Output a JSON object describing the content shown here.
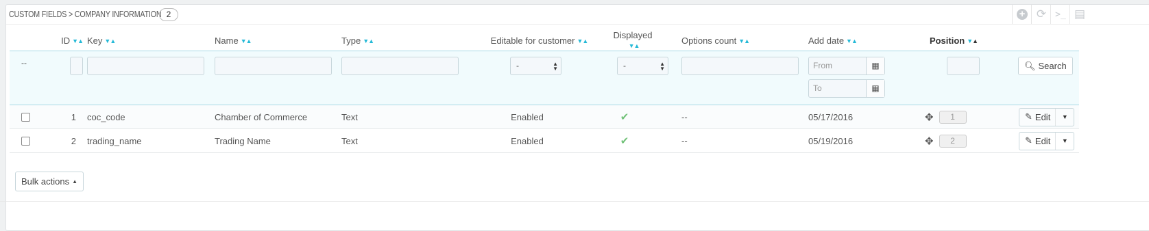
{
  "panel": {
    "title": "CUSTOM FIELDS > COMPANY INFORMATION",
    "count": "2",
    "toolbar": [
      {
        "name": "add-new-icon",
        "glyph": "+"
      },
      {
        "name": "refresh-icon",
        "glyph": "⟳"
      },
      {
        "name": "sql-query-icon",
        "glyph": ">_"
      },
      {
        "name": "export-icon",
        "glyph": "▤"
      }
    ]
  },
  "columns": {
    "id": "ID",
    "key": "Key",
    "name": "Name",
    "type": "Type",
    "editable": "Editable for customer",
    "displayed": "Displayed",
    "options_count": "Options count",
    "add_date": "Add date",
    "position": "Position"
  },
  "filters": {
    "dash": "--",
    "editable_select": "-",
    "displayed_select": "-",
    "date_from_placeholder": "From",
    "date_to_placeholder": "To",
    "search_label": "Search"
  },
  "rows": [
    {
      "id": "1",
      "key": "coc_code",
      "name": "Chamber of Commerce",
      "type": "Text",
      "editable": "Enabled",
      "displayed": "✔",
      "options_count": "--",
      "add_date": "05/17/2016",
      "position": "1",
      "edit_label": "Edit"
    },
    {
      "id": "2",
      "key": "trading_name",
      "name": "Trading Name",
      "type": "Text",
      "editable": "Enabled",
      "displayed": "✔",
      "options_count": "--",
      "add_date": "05/19/2016",
      "position": "2",
      "edit_label": "Edit"
    }
  ],
  "bulk_actions_label": "Bulk actions",
  "colors": {
    "accent": "#25b9d7",
    "enabled_check": "#72c279",
    "filter_bg": "#f1fbfd"
  }
}
